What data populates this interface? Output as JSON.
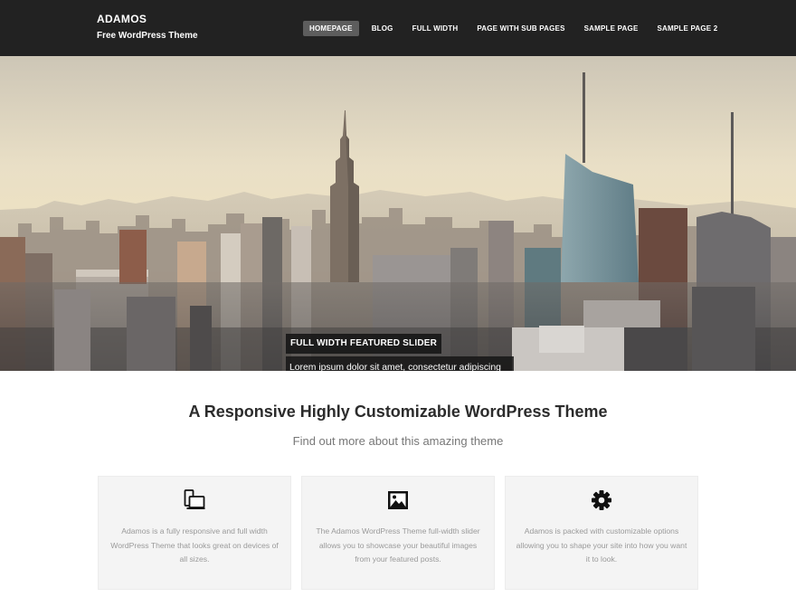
{
  "header": {
    "site_title": "ADAMOS",
    "tagline": "Free WordPress Theme"
  },
  "nav": {
    "items": [
      {
        "label": "HOMEPAGE",
        "active": true
      },
      {
        "label": "BLOG",
        "active": false
      },
      {
        "label": "FULL WIDTH",
        "active": false
      },
      {
        "label": "PAGE WITH SUB PAGES",
        "active": false
      },
      {
        "label": "SAMPLE PAGE",
        "active": false
      },
      {
        "label": "SAMPLE PAGE 2",
        "active": false
      }
    ]
  },
  "slider": {
    "caption_title": "FULL WIDTH FEATURED SLIDER",
    "caption_text": "Lorem ipsum dolor sit amet, consectetur adipiscing elit. Cras quis est porta, imperdiet neque et, aliquet justo. Suspendisse ultrices tristique magna, ..."
  },
  "intro": {
    "heading": "A Responsive Highly Customizable WordPress Theme",
    "subheading": "Find out more about this amazing theme"
  },
  "features": [
    {
      "icon": "devices-icon",
      "text": "Adamos is a fully responsive and full width WordPress Theme that looks great on devices of all sizes."
    },
    {
      "icon": "image-icon",
      "text": "The Adamos WordPress Theme full-width slider allows you to showcase your beautiful images from your featured posts."
    },
    {
      "icon": "gear-icon",
      "text": "Adamos is packed with customizable options allowing you to shape your site into how you want it to look."
    }
  ],
  "colors": {
    "header_bg": "#222222",
    "nav_active_bg": "#5d5d5d",
    "feature_bg": "#f4f4f4",
    "caption_bg": "#141414"
  }
}
